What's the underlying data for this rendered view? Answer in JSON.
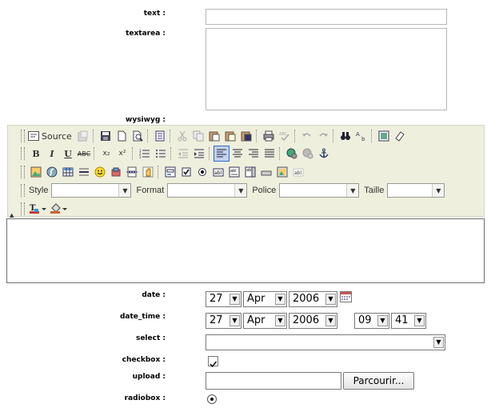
{
  "labels": {
    "text": "text :",
    "textarea": "textarea :",
    "wysiwyg": "wysiwyg :",
    "date": "date :",
    "date_time": "date_time :",
    "select": "select :",
    "checkbox": "checkbox :",
    "upload": "upload :",
    "radiobox": "radiobox :"
  },
  "text_value": "",
  "textarea_value": "",
  "toolbar": {
    "source_label": "Source",
    "style_label": "Style",
    "format_label": "Format",
    "police_label": "Police",
    "taille_label": "Taille",
    "style_value": "",
    "format_value": "",
    "police_value": "",
    "taille_value": "",
    "bold": "B",
    "italic": "I",
    "underline": "U",
    "strike": "ABC",
    "subscript": "x₂",
    "superscript": "x²"
  },
  "date": {
    "day": "27",
    "month": "Apr",
    "year": "2006"
  },
  "date_time": {
    "day": "27",
    "month": "Apr",
    "year": "2006",
    "hour": "09",
    "minute": "41"
  },
  "select_value": "",
  "checkbox_checked": true,
  "upload": {
    "value": "",
    "button": "Parcourir..."
  },
  "radiobox_selected": true
}
